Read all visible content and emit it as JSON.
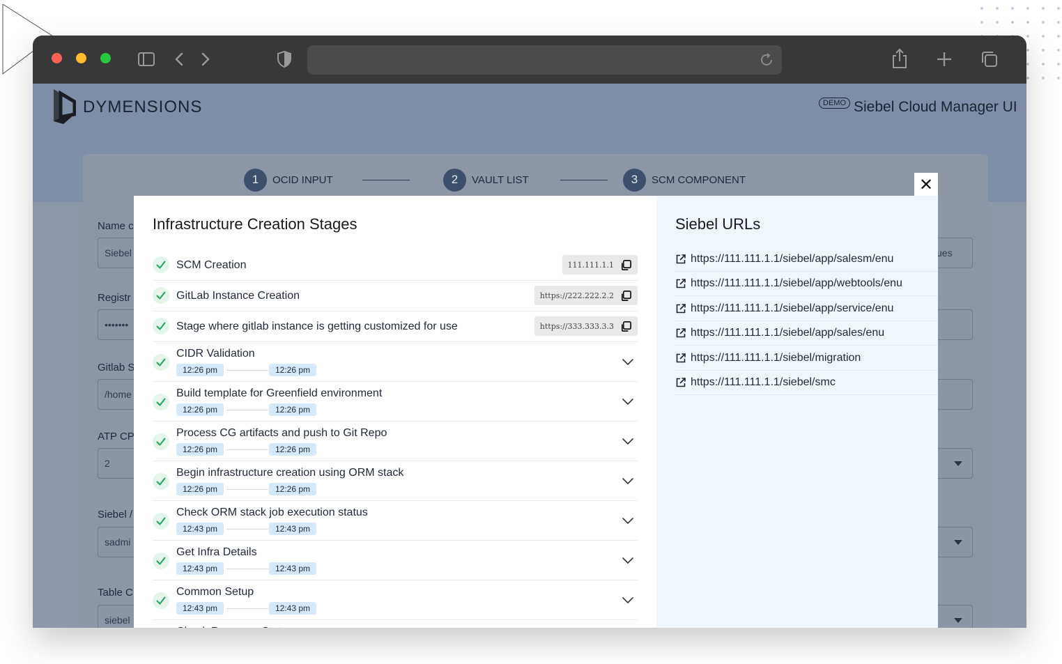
{
  "brand": {
    "name": "DYMENSIONS",
    "demo_badge": "DEMO",
    "app_title": "Siebel Cloud Manager UI"
  },
  "stepper": [
    {
      "num": "1",
      "label": "OCID INPUT"
    },
    {
      "num": "2",
      "label": "VAULT LIST"
    },
    {
      "num": "3",
      "label": "SCM COMPONENT"
    }
  ],
  "form": {
    "labels": [
      "Name c",
      "Registr",
      "Gitlab S",
      "ATP CP",
      "Siebel /",
      "Table C"
    ],
    "values": [
      "Siebel",
      "•••••••",
      "/home",
      "2",
      "sadmi",
      "siebel"
    ],
    "right_value": "ues"
  },
  "modal": {
    "stages_title": "Infrastructure Creation Stages",
    "urls_title": "Siebel URLs",
    "close_label": "✕",
    "stages": [
      {
        "name": "SCM Creation",
        "chip": "111.111.1.1"
      },
      {
        "name": "GitLab Instance Creation",
        "chip": "https://222.222.2.2"
      },
      {
        "name": "Stage where gitlab instance is getting customized for use",
        "chip": "https://333.333.3.3"
      }
    ],
    "timed_stages": [
      {
        "name": "CIDR Validation",
        "start": "12:26 pm",
        "end": "12:26 pm"
      },
      {
        "name": "Build template for Greenfield environment",
        "start": "12:26 pm",
        "end": "12:26 pm"
      },
      {
        "name": "Process CG artifacts and push to Git Repo",
        "start": "12:26 pm",
        "end": "12:26 pm"
      },
      {
        "name": "Begin infrastructure creation using ORM stack",
        "start": "12:26 pm",
        "end": "12:26 pm"
      },
      {
        "name": "Check ORM stack job execution status",
        "start": "12:43 pm",
        "end": "12:43 pm"
      },
      {
        "name": "Get Infra Details",
        "start": "12:43 pm",
        "end": "12:43 pm"
      },
      {
        "name": "Common Setup",
        "start": "12:43 pm",
        "end": "12:43 pm"
      },
      {
        "name": "Check Resource State",
        "start": "",
        "end": ""
      }
    ],
    "urls": [
      "https://111.111.1.1/siebel/app/salesm/enu",
      "https://111.111.1.1/siebel/app/webtools/enu",
      "https://111.111.1.1/siebel/app/service/enu",
      "https://111.111.1.1/siebel/app/sales/enu",
      "https://111.111.1.1/siebel/migration",
      "https://111.111.1.1/siebel/smc"
    ]
  },
  "colors": {
    "accent": "#3d4f6b",
    "check_green": "#22a55a",
    "time_chip": "#d6e9fb",
    "url_panel": "#eff6fd"
  }
}
